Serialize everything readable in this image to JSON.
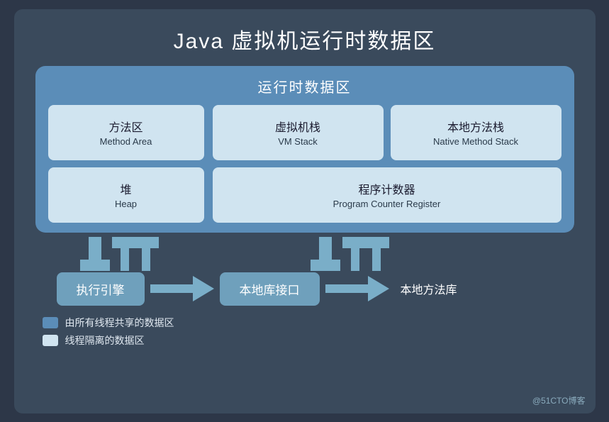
{
  "title": "Java 虚拟机运行时数据区",
  "runtime_box_title": "运行时数据区",
  "cells": {
    "method_area_cn": "方法区",
    "method_area_en": "Method Area",
    "heap_cn": "堆",
    "heap_en": "Heap",
    "vm_stack_cn": "虚拟机栈",
    "vm_stack_en": "VM Stack",
    "native_stack_cn": "本地方法栈",
    "native_stack_en": "Native Method Stack",
    "counter_cn": "程序计数器",
    "counter_en": "Program Counter Register"
  },
  "bottom": {
    "execution_engine": "执行引擎",
    "native_interface": "本地库接口",
    "native_library": "本地方法库"
  },
  "legend": {
    "shared_label": "由所有线程共享的数据区",
    "isolated_label": "线程隔离的数据区"
  },
  "watermark": "@51CTO博客"
}
